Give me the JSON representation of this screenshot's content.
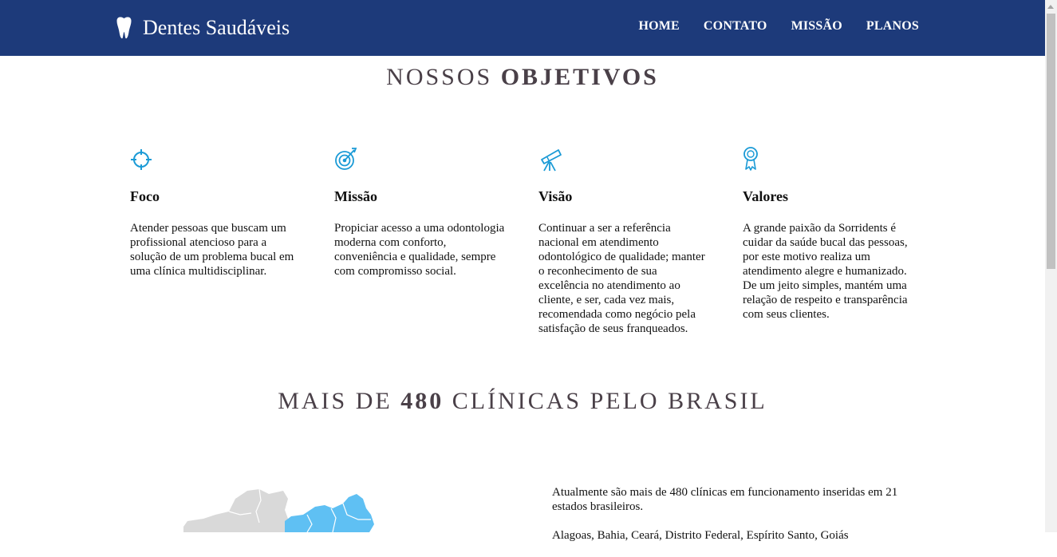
{
  "header": {
    "brand": "Dentes Saudáveis",
    "nav": [
      {
        "label": "HOME"
      },
      {
        "label": "CONTATO"
      },
      {
        "label": "MISSÃO"
      },
      {
        "label": "PLANOS"
      }
    ]
  },
  "objectives": {
    "title_normal": "NOSSOS",
    "title_bold": "OBJETIVOS",
    "items": [
      {
        "icon": "crosshair-icon",
        "title": "Foco",
        "text": "Atender pessoas que buscam um profissional atencioso para a solução de um problema bucal em uma clínica multidisciplinar."
      },
      {
        "icon": "target-icon",
        "title": "Missão",
        "text": "Propiciar acesso a uma odontologia moderna com conforto, conveniência e qualidade, sempre com compromisso social."
      },
      {
        "icon": "telescope-icon",
        "title": "Visão",
        "text": "Continuar a ser a referência nacional em atendimento odontológico de qualidade; manter o reconhecimento de sua excelência no atendimento ao cliente, e ser, cada vez mais, recomendada como negócio pela satisfação de seus franqueados."
      },
      {
        "icon": "award-icon",
        "title": "Valores",
        "text": "A grande paixão da Sorridents é cuidar da saúde bucal das pessoas, por este motivo realiza um atendimento alegre e humanizado. De um jeito simples, mantém uma relação de respeito e transparência com seus clientes."
      }
    ]
  },
  "clinics": {
    "title_prefix": "MAIS DE",
    "title_number": "480",
    "title_suffix": "CLÍNICAS PELO BRASIL",
    "paragraphs": [
      "Atualmente são mais de 480 clínicas em funcionamento inseridas em 21 estados brasileiros.",
      "Alagoas, Bahia, Ceará, Distrito Federal, Espírito Santo, Goiás"
    ]
  },
  "colors": {
    "navbar": "#1d3a7a",
    "icon_accent": "#1a9ad6",
    "map_grey": "#d9d9d9",
    "map_blue": "#5fc0f3",
    "title_text": "#4a4048"
  }
}
